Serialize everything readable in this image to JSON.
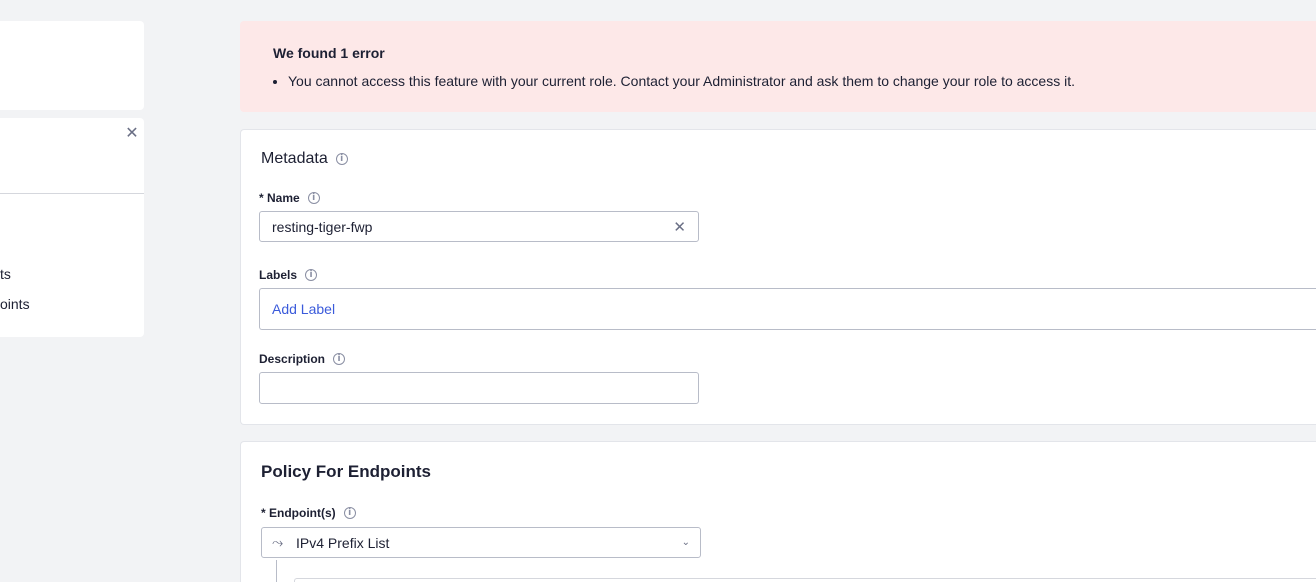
{
  "sidebar": {
    "items": [
      {
        "label": "ts"
      },
      {
        "label": "oints"
      }
    ],
    "close_icon": "close-icon"
  },
  "error": {
    "title": "We found 1 error",
    "messages": [
      "You cannot access this feature with your current role. Contact your Administrator and ask them to change your role to access it."
    ]
  },
  "metadata": {
    "title": "Metadata",
    "name_label": "* Name",
    "name_value": "resting-tiger-fwp",
    "labels_label": "Labels",
    "add_label": "Add Label",
    "description_label": "Description",
    "description_value": ""
  },
  "policy": {
    "title": "Policy For Endpoints",
    "endpoints_label": "* Endpoint(s)",
    "endpoints_value": "IPv4 Prefix List"
  },
  "colors": {
    "error_bg": "#fde8e8",
    "accent_link": "#3b5bdb",
    "page_bg": "#f2f3f5"
  }
}
